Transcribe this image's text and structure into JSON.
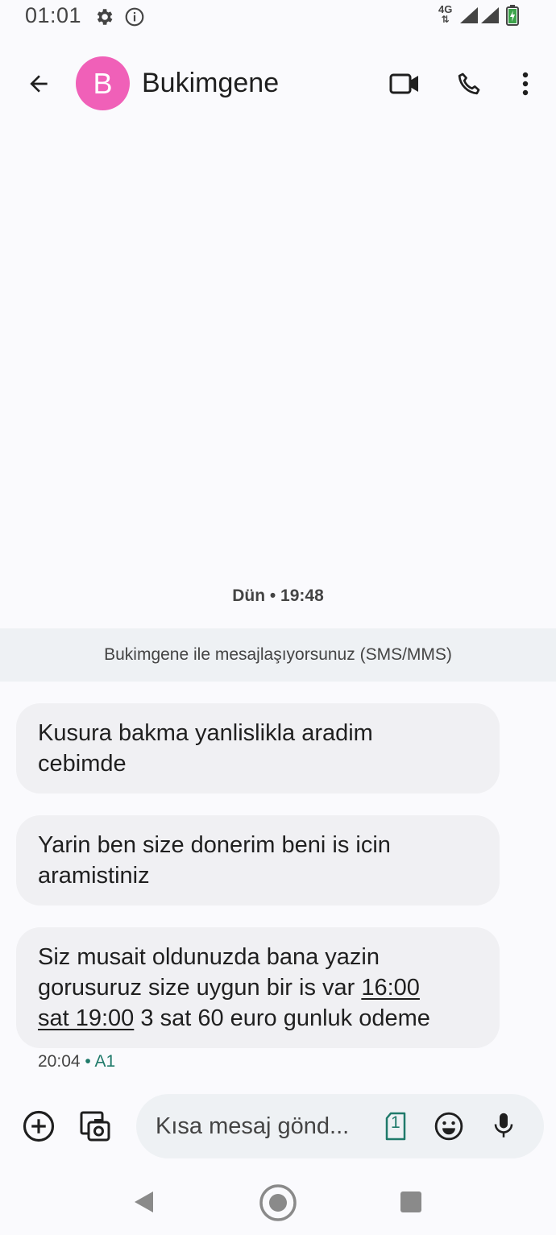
{
  "status_bar": {
    "time": "01:01",
    "network_label": "4G",
    "icons": [
      "settings-icon",
      "info-icon",
      "signal-icon",
      "signal-icon",
      "battery-charging-icon"
    ]
  },
  "header": {
    "avatar_letter": "B",
    "contact_name": "Bukimgene",
    "avatar_color": "#f060b8",
    "icons": [
      "back-arrow-icon",
      "video-call-icon",
      "phone-icon",
      "more-vert-icon"
    ]
  },
  "conversation": {
    "date_separator": "Dün • 19:48",
    "info_banner": "Bukimgene ile mesajlaşıyorsunuz (SMS/MMS)",
    "messages": [
      {
        "line1": "Kusura bakma yanlislikla aradim",
        "line2": "cebimde"
      },
      {
        "line1": "Yarin ben size donerim  beni is icin",
        "line2": "aramistiniz"
      },
      {
        "part1": "Siz musait oldunuzda bana yazin",
        "part2": "gorusuruz size uygun bir is var ",
        "link1": "16:00",
        "link2": "sat 19:00",
        "part3": " 3 sat 60 euro gunluk odeme"
      }
    ],
    "last_meta": {
      "time": "20:04",
      "sim": "A1"
    }
  },
  "compose": {
    "placeholder": "Kısa mesaj gönd...",
    "sim_label": "1",
    "icons": [
      "add-circle-icon",
      "gallery-icon",
      "sim-card-icon",
      "emoji-icon",
      "mic-icon"
    ]
  },
  "nav_bar": {
    "icons": [
      "nav-back-icon",
      "nav-home-icon",
      "nav-recents-icon"
    ]
  },
  "colors": {
    "background": "#fafafd",
    "bubble": "#f0f0f3",
    "banner": "#eef1f4",
    "sim_accent": "#1f7a6a"
  }
}
